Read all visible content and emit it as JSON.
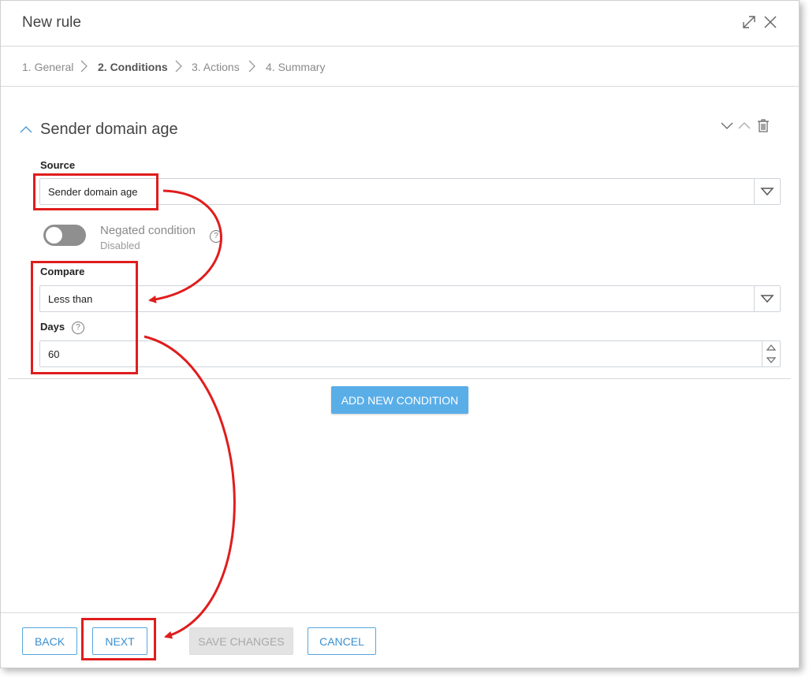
{
  "dialog": {
    "title": "New rule",
    "expand_icon": "expand-icon",
    "close_icon": "close-icon"
  },
  "steps": [
    {
      "label": "1. General",
      "active": false
    },
    {
      "label": "2. Conditions",
      "active": true
    },
    {
      "label": "3. Actions",
      "active": false
    },
    {
      "label": "4. Summary",
      "active": false
    }
  ],
  "condition": {
    "title": "Sender domain age",
    "source_label": "Source",
    "source_value": "Sender domain age",
    "negated_label": "Negated condition",
    "negated_state": "Disabled",
    "compare_label": "Compare",
    "compare_value": "Less than",
    "days_label": "Days",
    "days_value": "60"
  },
  "add_condition_label": "ADD NEW CONDITION",
  "footer": {
    "back": "BACK",
    "next": "NEXT",
    "save": "SAVE CHANGES",
    "cancel": "CANCEL"
  },
  "colors": {
    "accent": "#5aaee8",
    "annotation": "#e01d1d"
  }
}
